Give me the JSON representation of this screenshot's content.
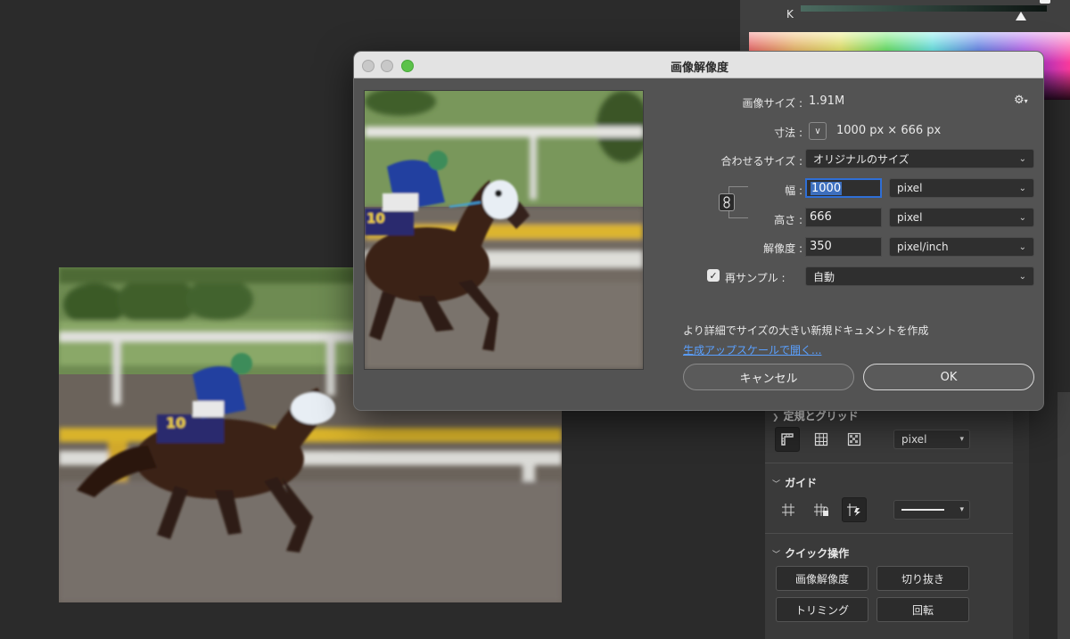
{
  "color_panel": {
    "channel_label": "K"
  },
  "dialog": {
    "title": "画像解像度",
    "image_size_label": "画像サイズ :",
    "image_size_value": "1.91M",
    "dimensions_label": "寸法 :",
    "dimensions_value": "1000 px × 666 px",
    "fit_to_label": "合わせるサイズ :",
    "fit_to_value": "オリジナルのサイズ",
    "width_label": "幅 :",
    "width_value": "1000",
    "width_unit": "pixel",
    "height_label": "高さ :",
    "height_value": "666",
    "height_unit": "pixel",
    "resolution_label": "解像度 :",
    "resolution_value": "350",
    "resolution_unit": "pixel/inch",
    "resample_label": "再サンプル :",
    "resample_value": "自動",
    "resample_checked": true,
    "info_text": "より詳細でサイズの大きい新規ドキュメントを作成",
    "link_text": "生成アップスケールで開く...",
    "cancel_label": "キャンセル",
    "ok_label": "OK"
  },
  "properties": {
    "rulers_section_title": "定規とグリッド",
    "rulers_unit": "pixel",
    "guides_section_title": "ガイド",
    "quick_actions_title": "クイック操作",
    "quick_actions": [
      "画像解像度",
      "切り抜き",
      "トリミング",
      "回転"
    ]
  },
  "colors": {
    "accent": "#2f6fd6",
    "link": "#5aa0ff",
    "close": "#c8c8c8",
    "zoom": "#5cc24a"
  }
}
